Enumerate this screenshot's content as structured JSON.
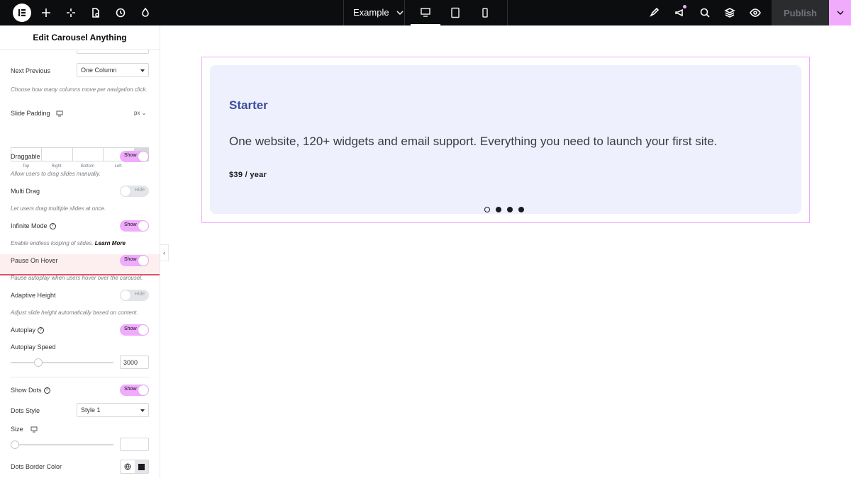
{
  "topbar": {
    "document_title": "Example",
    "publish_label": "Publish"
  },
  "panel": {
    "title": "Edit Carousel Anything",
    "next_previous": {
      "label": "Next Previous",
      "value": "One Column",
      "desc": "Choose how many columns move per navigation click."
    },
    "slide_padding": {
      "label": "Slide Padding",
      "unit": "px",
      "fields": [
        "Top",
        "Right",
        "Bottom",
        "Left"
      ]
    },
    "draggable": {
      "label": "Draggable",
      "state": "Show",
      "desc": "Allow users to drag slides manually."
    },
    "multi_drag": {
      "label": "Multi Drag",
      "state": "Hide",
      "desc": "Let users drag multiple slides at once."
    },
    "infinite_mode": {
      "label": "Infinite Mode",
      "state": "Show",
      "desc": "Enable endless looping of slides.",
      "learn_more": "Learn More"
    },
    "pause_on_hover": {
      "label": "Pause On Hover",
      "state": "Show",
      "desc": "Pause autoplay when users hover over the carousel."
    },
    "adaptive_height": {
      "label": "Adaptive Height",
      "state": "Hide",
      "desc": "Adjust slide height automatically based on content."
    },
    "autoplay": {
      "label": "Autoplay",
      "state": "Show"
    },
    "autoplay_speed": {
      "label": "Autoplay Speed",
      "value": "3000",
      "slider_fraction": 0.27
    },
    "show_dots": {
      "label": "Show Dots",
      "state": "Show"
    },
    "dots_style": {
      "label": "Dots Style",
      "value": "Style 1"
    },
    "size": {
      "label": "Size",
      "slider_fraction": 0.0
    },
    "dots_border_color": {
      "label": "Dots Border Color"
    }
  },
  "canvas": {
    "card": {
      "title": "Starter",
      "description": "One website, 120+ widgets and email support. Everything you need to launch your first site.",
      "price": "$39 / year"
    },
    "dots_count": 4,
    "active_dot": 0
  },
  "colors": {
    "accent": "#f0abfc",
    "card_bg": "#eef0fd",
    "card_title": "#3b4ea0",
    "highlight_border": "#e05263"
  }
}
